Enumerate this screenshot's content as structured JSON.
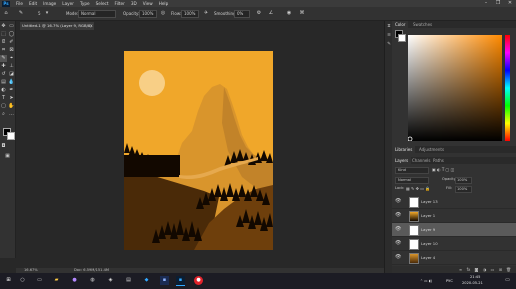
{
  "menu": [
    "File",
    "Edit",
    "Image",
    "Layer",
    "Type",
    "Select",
    "Filter",
    "3D",
    "View",
    "Help"
  ],
  "app_logo": "Ps",
  "window_controls": {
    "minimize": "–",
    "maximize": "❐",
    "close": "✕"
  },
  "options": {
    "size": "5",
    "mode_label": "Mode:",
    "mode_value": "Normal",
    "opacity_label": "Opacity:",
    "opacity_value": "100%",
    "flow_label": "Flow:",
    "flow_value": "100%",
    "smoothing_label": "Smoothing:",
    "smoothing_value": "0%"
  },
  "document": {
    "tab_title": "Untitled-1 @ 16.7% (Layer 9, RGB/8)",
    "close": "×"
  },
  "status": {
    "zoom": "16.67%",
    "doc_size": "Doc: 6.59M/151.4M"
  },
  "panels": {
    "color_tab": "Color",
    "swatches_tab": "Swatches",
    "learn_tab": "Libraries",
    "adjust_tab": "Adjustments",
    "layers_tab": "Layers",
    "channels_tab": "Channels",
    "paths_tab": "Paths"
  },
  "layers_controls": {
    "kind": "Kind",
    "blend": "Normal",
    "opacity_label": "Opacity:",
    "opacity_value": "100%",
    "lock_label": "Lock:",
    "fill_label": "Fill:",
    "fill_value": "100%"
  },
  "layers": [
    {
      "name": "Layer 13",
      "selected": false
    },
    {
      "name": "Layer 1",
      "selected": false
    },
    {
      "name": "Layer 9",
      "selected": true
    },
    {
      "name": "Layer 10",
      "selected": false
    },
    {
      "name": "Layer 4",
      "selected": false
    }
  ],
  "taskbar": {
    "lang": "РУС",
    "time": "21:45",
    "date": "2020-05-21"
  },
  "colors": {
    "sky": "#f0a72a",
    "sun": "#f8cf86",
    "mountain_light": "#d9952c",
    "mountain_dark": "#c28329",
    "ground": "#4a2a08",
    "trees": "#120800",
    "accent_blue": "#31a8ff"
  }
}
